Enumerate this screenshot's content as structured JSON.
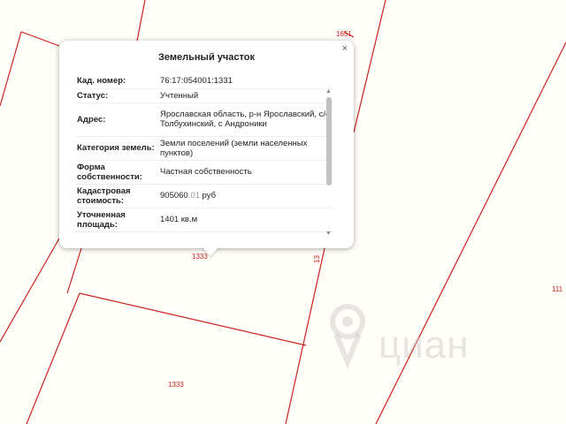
{
  "map": {
    "boundary_color": "#cc2222",
    "background_color": "#fffef7",
    "parcel_labels": [
      "1651",
      "1333",
      "1333",
      "13",
      "111"
    ]
  },
  "watermark": {
    "text": "циан",
    "icon": "map-pin-icon"
  },
  "popup": {
    "title": "Земельный участок",
    "close_label": "×",
    "rows": [
      {
        "key": "Кад. номер:",
        "value": "76:17:054001:1331"
      },
      {
        "key": "Статус:",
        "value": "Учтенный"
      },
      {
        "key": "Адрес:",
        "value": "Ярославская область, р-н Ярославский, с/о Толбухинский, с Андроники"
      },
      {
        "key": "Категория земель:",
        "value": "Земли поселений (земли населенных пунктов)"
      },
      {
        "key": "Форма собственности:",
        "value": "Частная собственность"
      },
      {
        "key": "Кадастровая стоимость:",
        "value_main": "905060",
        "value_cents": ".01",
        "value_unit": " руб"
      },
      {
        "key": "Уточненная площадь:",
        "value": "1401 кв.м"
      }
    ],
    "scroll_up": "▲",
    "scroll_down": "▼"
  }
}
